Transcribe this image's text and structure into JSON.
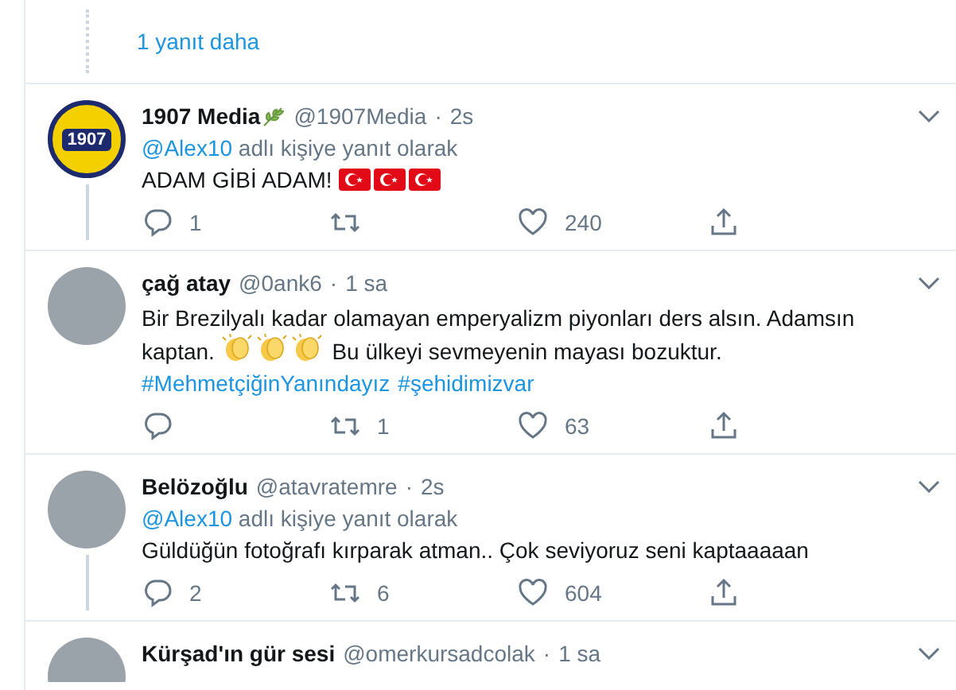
{
  "more_replies": {
    "label": "1 yanıt daha"
  },
  "tweets": [
    {
      "name": "1907 Media",
      "name_badge": true,
      "handle": "@1907Media",
      "separator": "·",
      "time": "2s",
      "avatar": {
        "kind": "logo",
        "text": "1907"
      },
      "reply_to": {
        "handle": "@Alex10",
        "text": "adlı kişiye yanıt olarak"
      },
      "body": [
        {
          "kind": "text",
          "text": "ADAM GİBİ ADAM! "
        },
        {
          "kind": "flag"
        },
        {
          "kind": "flag"
        },
        {
          "kind": "flag"
        }
      ],
      "thread_line": true,
      "actions": {
        "replies": "1",
        "likes": "240"
      }
    },
    {
      "name": "çağ atay",
      "name_badge": false,
      "handle": "@0ank6",
      "separator": "·",
      "time": "1 sa",
      "avatar": {
        "kind": "photo"
      },
      "body": [
        {
          "kind": "text",
          "text": "Bir Brezilyalı kadar olamayan emperyalizm piyonları ders alsın. Adamsın kaptan. "
        },
        {
          "kind": "clap"
        },
        {
          "kind": "clap"
        },
        {
          "kind": "clap"
        },
        {
          "kind": "text",
          "text": " Bu ülkeyi sevmeyenin mayası bozuktur."
        }
      ],
      "hashtags": [
        "#MehmetçiğinYanındayız",
        "#şehidimizvar"
      ],
      "thread_line": false,
      "actions": {
        "retweets": "1",
        "likes": "63"
      }
    },
    {
      "name": "Belözoğlu",
      "name_badge": false,
      "handle": "@atavratemre",
      "separator": "·",
      "time": "2s",
      "avatar": {
        "kind": "photo"
      },
      "reply_to": {
        "handle": "@Alex10",
        "text": "adlı kişiye yanıt olarak"
      },
      "body": [
        {
          "kind": "text",
          "text": "Güldüğün fotoğrafı kırparak atman.. Çok seviyoruz seni kaptaaaaan"
        }
      ],
      "thread_line": true,
      "actions": {
        "replies": "2",
        "retweets": "6",
        "likes": "604"
      }
    },
    {
      "name": "Kürşad'ın gür sesi",
      "name_badge": false,
      "handle": "@omerkursadcolak",
      "separator": "·",
      "time": "1 sa",
      "avatar": {
        "kind": "photo"
      }
    }
  ]
}
